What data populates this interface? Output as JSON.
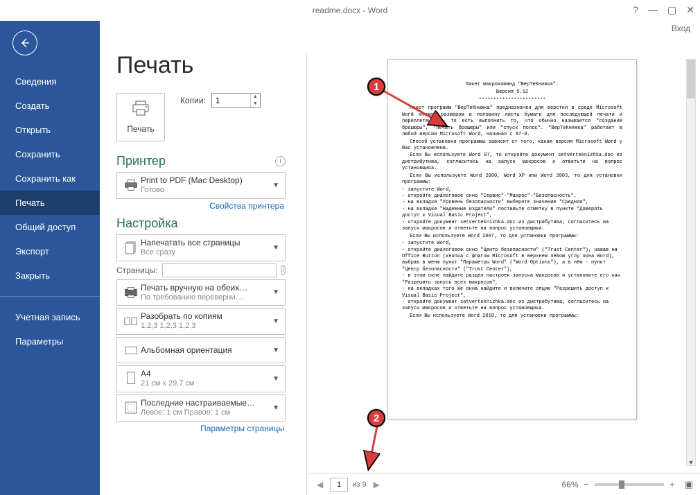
{
  "window": {
    "title": "readme.docx - Word",
    "login": "Вход"
  },
  "sidebar": {
    "items": [
      "Сведения",
      "Создать",
      "Открыть",
      "Сохранить",
      "Сохранить как",
      "Печать",
      "Общий доступ",
      "Экспорт",
      "Закрыть"
    ],
    "group2": [
      "Учетная запись",
      "Параметры"
    ],
    "active_index": 5
  },
  "page_title": "Печать",
  "print_button": "Печать",
  "copies": {
    "label": "Копии:",
    "value": "1"
  },
  "sections": {
    "printer": {
      "title": "Принтер",
      "dropdown": {
        "title": "Print to PDF (Mac Desktop)",
        "sub": "Готово"
      },
      "link": "Свойства принтера"
    },
    "settings": {
      "title": "Настройка",
      "items": [
        {
          "title": "Напечатать все страницы",
          "sub": "Все сразу"
        },
        {
          "label": "Страницы:",
          "value": ""
        },
        {
          "title": "Печать вручную на обеих…",
          "sub": "По требованию переверни…"
        },
        {
          "title": "Разобрать по копиям",
          "sub": "1,2,3   1,2,3   1,2,3"
        },
        {
          "title": "Альбомная ориентация",
          "sub": ""
        },
        {
          "title": "A4",
          "sub": "21 см x 29,7 см"
        },
        {
          "title": "Последние настраиваемые…",
          "sub": "Левое: 1 см   Правое: 1 см"
        }
      ],
      "link": "Параметры страницы"
    }
  },
  "preview": {
    "page": "1",
    "of_label": "из 9",
    "zoom": "66%",
    "doc": {
      "t1": "Пакет макрокоманд \"ВерТеКнижка\".",
      "t2": "Версия 5.12",
      "t3": "***********************",
      "p1": "Пакет программ \"ВерТеКнижка\" предназначен для верстки в среде Microsoft Word книжек размером в половину листа бумаги для последующей печати и переплетения - то есть выполнить то, что обычно называется \"создание брошюры\", \"печать брошюры\" или \"спуск полос\". \"ВерТеКнижка\" работает в любой версии Microsoft Word, начиная с 97-й.",
      "p2": "Способ установки программы зависит от того, какая версия Microsoft Word у Вас установлена.",
      "p3": "Если Вы используете Word 97, то откройте документ setverteknizhka.doc из дистрибутива, согласитесь на запуск макросов и ответьте на вопрос установщика.",
      "p4": "Если Вы используете Word 2000, Word XP или Word 2003, то для установки программы:",
      "l1": "- запустите Word,",
      "l2": "- откройте диалоговое окно \"Сервис\"-\"Макрос\"-\"Безопасность\",",
      "l3": "- на вкладке \"Уровень безопасности\" выберите значение \"Средняя\",",
      "l4": "- на вкладке \"Надежные издатели\" поставьте отметку в пункте \"Доверять доступ к Visual Basic Project\",",
      "l5": "- откройте документ setverteknizhka.doc из дистрибутива, согласитесь на запуск макросов и ответьте на вопрос установщика.",
      "p5": "Если Вы используете Word 2007, то для установки программы:",
      "l6": "- запустите Word,",
      "l7": "- откройте диалоговое окно \"Центр безопасности\" (\"Trust Center\"), нажав на Office Button (кнопка с флагом Microsoft в верхнем левом углу окна Word), выбрав в меню пункт \"Параметры Word\" (\"Word Options\"), а в нём - пункт \"Центр безопасности\" (\"Trust Center\"),",
      "l8": "- в этом окне найдите раздел настроек запуска макросов и установите его как \"Разрешить запуск всех макросов\",",
      "l9": "- на вкладках того же окна найдите и включите опцию \"Разрешить доступ к Visual Basic Project\",",
      "l10": "- откройте документ setverteknizhka.doc из дистрибутива, согласитесь на запуск макросов и ответьте на вопрос установщика.",
      "p6": "Если Вы используете Word 2010, то для установки программы:"
    }
  },
  "annotations": {
    "a1": "1",
    "a2": "2"
  }
}
